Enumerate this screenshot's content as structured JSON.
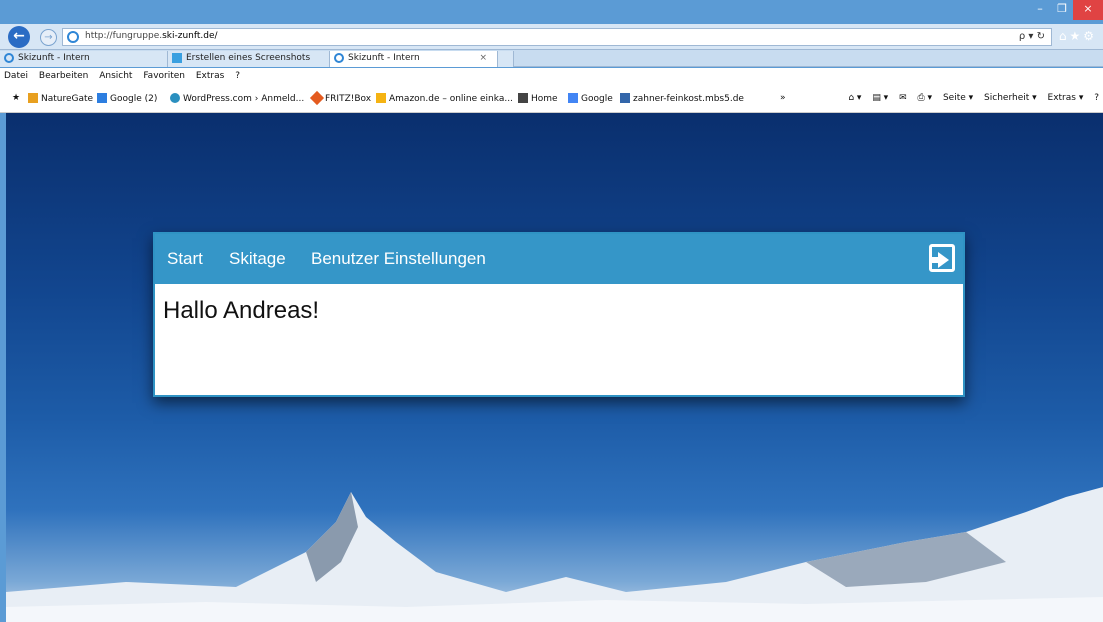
{
  "browser": {
    "url_prefix": "http://fungruppe.",
    "url_domain": "ski-zunft.de/",
    "address_tools": "ρ ▾ ↻",
    "right_icons": "⌂★⚙",
    "window_controls": {
      "minimize": "–",
      "restore": "❐",
      "close": "×"
    },
    "tabs": [
      {
        "label": "Skizunft - Intern",
        "active": false
      },
      {
        "label": "Erstellen eines Screenshots",
        "active": false
      },
      {
        "label": "Skizunft - Intern",
        "active": true,
        "close": "×"
      }
    ],
    "menu": [
      "Datei",
      "Bearbeiten",
      "Ansicht",
      "Favoriten",
      "Extras",
      "?"
    ],
    "favorites": [
      "NatureGate",
      "Google (2)",
      "WordPress.com › Anmeld...",
      "FRITZ!Box",
      "Amazon.de – online einka...",
      "Home",
      "Google",
      "zahner-feinkost.mbs5.de"
    ],
    "overflow": "»",
    "commands": [
      "Seite ▾",
      "Sicherheit ▾",
      "Extras ▾",
      "?"
    ]
  },
  "app": {
    "nav": [
      "Start",
      "Skitage",
      "Benutzer Einstellungen"
    ],
    "greeting": "Hallo Andreas!"
  },
  "colors": {
    "nav_bg": "#3596c8",
    "panel_border": "#2f93c4",
    "chrome": "#5b9bd5"
  },
  "icons": [
    "back-arrow-icon",
    "forward-arrow-icon",
    "ie-logo-icon",
    "home-icon",
    "star-icon",
    "gear-icon",
    "logout-icon"
  ]
}
